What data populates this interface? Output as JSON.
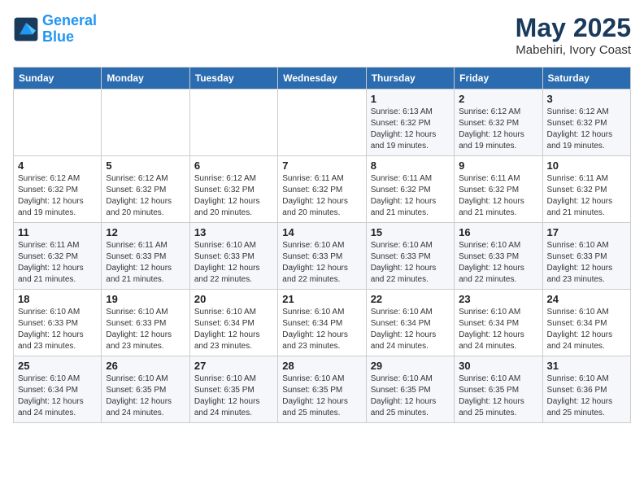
{
  "header": {
    "logo_line1": "General",
    "logo_line2": "Blue",
    "title": "May 2025",
    "subtitle": "Mabehiri, Ivory Coast"
  },
  "weekdays": [
    "Sunday",
    "Monday",
    "Tuesday",
    "Wednesday",
    "Thursday",
    "Friday",
    "Saturday"
  ],
  "weeks": [
    [
      {
        "day": "",
        "info": ""
      },
      {
        "day": "",
        "info": ""
      },
      {
        "day": "",
        "info": ""
      },
      {
        "day": "",
        "info": ""
      },
      {
        "day": "1",
        "info": "Sunrise: 6:13 AM\nSunset: 6:32 PM\nDaylight: 12 hours\nand 19 minutes."
      },
      {
        "day": "2",
        "info": "Sunrise: 6:12 AM\nSunset: 6:32 PM\nDaylight: 12 hours\nand 19 minutes."
      },
      {
        "day": "3",
        "info": "Sunrise: 6:12 AM\nSunset: 6:32 PM\nDaylight: 12 hours\nand 19 minutes."
      }
    ],
    [
      {
        "day": "4",
        "info": "Sunrise: 6:12 AM\nSunset: 6:32 PM\nDaylight: 12 hours\nand 19 minutes."
      },
      {
        "day": "5",
        "info": "Sunrise: 6:12 AM\nSunset: 6:32 PM\nDaylight: 12 hours\nand 20 minutes."
      },
      {
        "day": "6",
        "info": "Sunrise: 6:12 AM\nSunset: 6:32 PM\nDaylight: 12 hours\nand 20 minutes."
      },
      {
        "day": "7",
        "info": "Sunrise: 6:11 AM\nSunset: 6:32 PM\nDaylight: 12 hours\nand 20 minutes."
      },
      {
        "day": "8",
        "info": "Sunrise: 6:11 AM\nSunset: 6:32 PM\nDaylight: 12 hours\nand 21 minutes."
      },
      {
        "day": "9",
        "info": "Sunrise: 6:11 AM\nSunset: 6:32 PM\nDaylight: 12 hours\nand 21 minutes."
      },
      {
        "day": "10",
        "info": "Sunrise: 6:11 AM\nSunset: 6:32 PM\nDaylight: 12 hours\nand 21 minutes."
      }
    ],
    [
      {
        "day": "11",
        "info": "Sunrise: 6:11 AM\nSunset: 6:32 PM\nDaylight: 12 hours\nand 21 minutes."
      },
      {
        "day": "12",
        "info": "Sunrise: 6:11 AM\nSunset: 6:33 PM\nDaylight: 12 hours\nand 21 minutes."
      },
      {
        "day": "13",
        "info": "Sunrise: 6:10 AM\nSunset: 6:33 PM\nDaylight: 12 hours\nand 22 minutes."
      },
      {
        "day": "14",
        "info": "Sunrise: 6:10 AM\nSunset: 6:33 PM\nDaylight: 12 hours\nand 22 minutes."
      },
      {
        "day": "15",
        "info": "Sunrise: 6:10 AM\nSunset: 6:33 PM\nDaylight: 12 hours\nand 22 minutes."
      },
      {
        "day": "16",
        "info": "Sunrise: 6:10 AM\nSunset: 6:33 PM\nDaylight: 12 hours\nand 22 minutes."
      },
      {
        "day": "17",
        "info": "Sunrise: 6:10 AM\nSunset: 6:33 PM\nDaylight: 12 hours\nand 23 minutes."
      }
    ],
    [
      {
        "day": "18",
        "info": "Sunrise: 6:10 AM\nSunset: 6:33 PM\nDaylight: 12 hours\nand 23 minutes."
      },
      {
        "day": "19",
        "info": "Sunrise: 6:10 AM\nSunset: 6:33 PM\nDaylight: 12 hours\nand 23 minutes."
      },
      {
        "day": "20",
        "info": "Sunrise: 6:10 AM\nSunset: 6:34 PM\nDaylight: 12 hours\nand 23 minutes."
      },
      {
        "day": "21",
        "info": "Sunrise: 6:10 AM\nSunset: 6:34 PM\nDaylight: 12 hours\nand 23 minutes."
      },
      {
        "day": "22",
        "info": "Sunrise: 6:10 AM\nSunset: 6:34 PM\nDaylight: 12 hours\nand 24 minutes."
      },
      {
        "day": "23",
        "info": "Sunrise: 6:10 AM\nSunset: 6:34 PM\nDaylight: 12 hours\nand 24 minutes."
      },
      {
        "day": "24",
        "info": "Sunrise: 6:10 AM\nSunset: 6:34 PM\nDaylight: 12 hours\nand 24 minutes."
      }
    ],
    [
      {
        "day": "25",
        "info": "Sunrise: 6:10 AM\nSunset: 6:34 PM\nDaylight: 12 hours\nand 24 minutes."
      },
      {
        "day": "26",
        "info": "Sunrise: 6:10 AM\nSunset: 6:35 PM\nDaylight: 12 hours\nand 24 minutes."
      },
      {
        "day": "27",
        "info": "Sunrise: 6:10 AM\nSunset: 6:35 PM\nDaylight: 12 hours\nand 24 minutes."
      },
      {
        "day": "28",
        "info": "Sunrise: 6:10 AM\nSunset: 6:35 PM\nDaylight: 12 hours\nand 25 minutes."
      },
      {
        "day": "29",
        "info": "Sunrise: 6:10 AM\nSunset: 6:35 PM\nDaylight: 12 hours\nand 25 minutes."
      },
      {
        "day": "30",
        "info": "Sunrise: 6:10 AM\nSunset: 6:35 PM\nDaylight: 12 hours\nand 25 minutes."
      },
      {
        "day": "31",
        "info": "Sunrise: 6:10 AM\nSunset: 6:36 PM\nDaylight: 12 hours\nand 25 minutes."
      }
    ]
  ]
}
